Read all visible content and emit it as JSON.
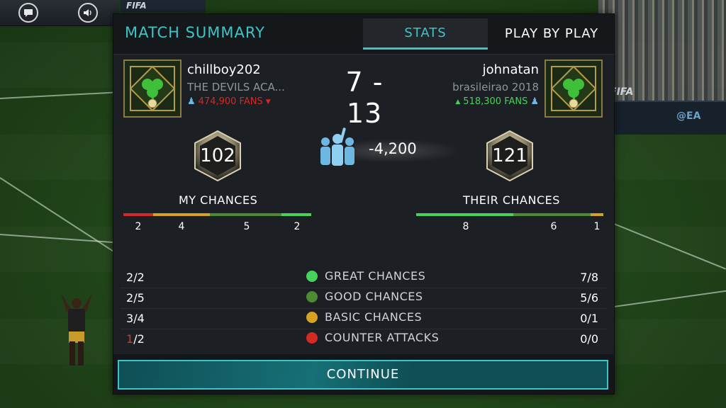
{
  "header": {
    "title": "MATCH SUMMARY",
    "tabs": [
      {
        "label": "STATS",
        "active": true
      },
      {
        "label": "PLAY BY PLAY",
        "active": false
      }
    ]
  },
  "top_buttons": {
    "chat_icon": "chat-bubble-icon",
    "sound_icon": "speaker-icon"
  },
  "background": {
    "ad_text_1": "FIFA",
    "ad_text_2": "FIFA",
    "ad_text_3": "@EA"
  },
  "home": {
    "name": "chillboy202",
    "club": "THE DEVILS ACA...",
    "fans": "474,900 FANS",
    "fans_trend": "down",
    "ovr": "102",
    "chances_label": "MY CHANCES",
    "bar_segments": [
      {
        "fraction": 0.16,
        "color": "#d42a24"
      },
      {
        "fraction": 0.3,
        "color": "#d8a224"
      },
      {
        "fraction": 0.38,
        "color": "#4c8a34"
      },
      {
        "fraction": 0.16,
        "color": "#45d35a"
      }
    ],
    "bar_values": [
      "2",
      "4",
      "5",
      "2"
    ]
  },
  "away": {
    "name": "johnatan",
    "club": "brasileirao 2018",
    "fans": "518,300 FANS",
    "fans_trend": "up",
    "ovr": "121",
    "chances_label": "THEIR CHANCES",
    "bar_segments": [
      {
        "fraction": 0.52,
        "color": "#45d35a"
      },
      {
        "fraction": 0.41,
        "color": "#4c8a34"
      },
      {
        "fraction": 0.07,
        "color": "#d8a224"
      }
    ],
    "bar_values": [
      "8",
      "6",
      "1"
    ]
  },
  "score": "7 - 13",
  "fan_difference": "-4,200",
  "stats": [
    {
      "left_num": "2",
      "left_den": "/2",
      "label": "GREAT CHANCES",
      "right": "7/8",
      "ball_color": "#45d35a"
    },
    {
      "left_num": "2",
      "left_den": "/5",
      "label": "GOOD CHANCES",
      "right": "5/6",
      "ball_color": "#4c8a34"
    },
    {
      "left_num": "3",
      "left_den": "/4",
      "label": "BASIC CHANCES",
      "right": "0/1",
      "ball_color": "#d8a224"
    },
    {
      "left_num": "1",
      "left_den": "/2",
      "label": "COUNTER ATTACKS",
      "right": "0/0",
      "ball_color": "#d42a24",
      "left_num_color": "#e2322d"
    }
  ],
  "continue_label": "CONTINUE",
  "colors": {
    "accent": "#3fc4c6",
    "panel": "#1c1f23",
    "fans_down": "#d42a24",
    "fans_up": "#45d35a"
  }
}
